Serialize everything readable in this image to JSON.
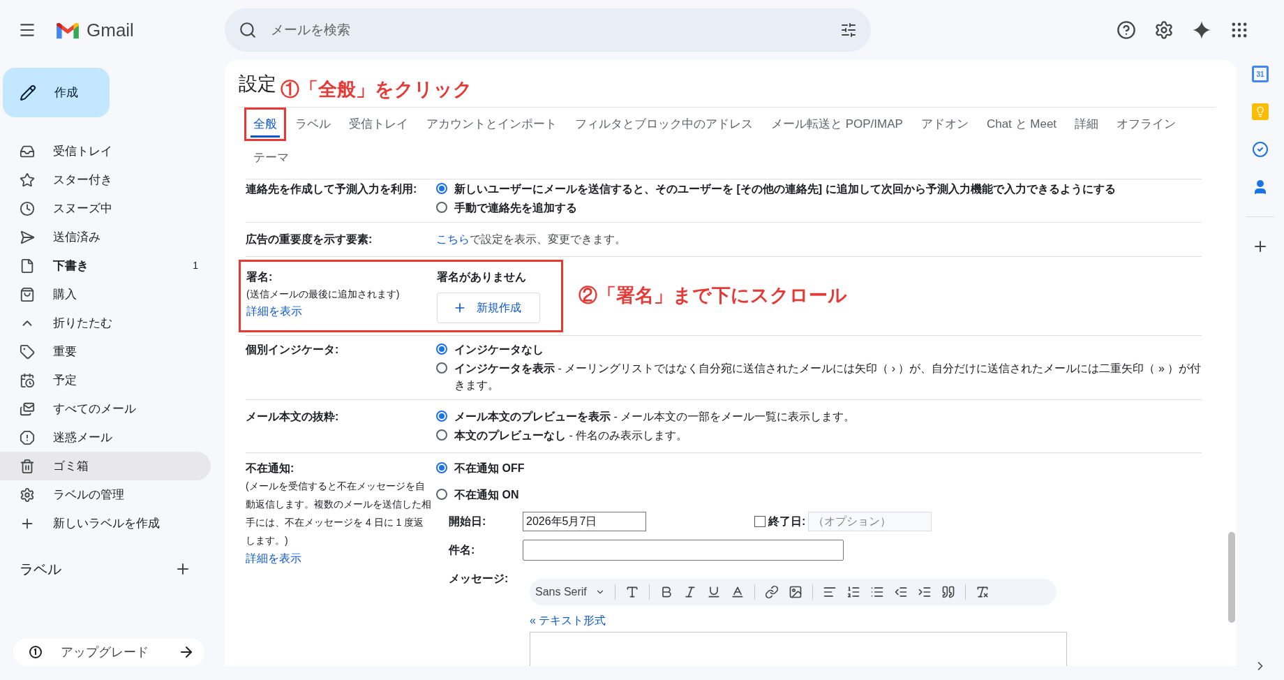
{
  "header": {
    "logo": "Gmail",
    "search": {
      "placeholder": "メールを検索"
    }
  },
  "sidebar": {
    "compose": "作成",
    "items": [
      {
        "label": "受信トレイ",
        "unread": false,
        "selected": false
      },
      {
        "label": "スター付き",
        "unread": false,
        "selected": false
      },
      {
        "label": "スヌーズ中",
        "unread": false,
        "selected": false
      },
      {
        "label": "送信済み",
        "unread": false,
        "selected": false
      },
      {
        "label": "下書き",
        "unread": true,
        "count": "1",
        "selected": false
      },
      {
        "label": "購入",
        "unread": false,
        "selected": false
      },
      {
        "label": "折りたたむ",
        "unread": false,
        "selected": false
      },
      {
        "label": "重要",
        "unread": false,
        "selected": false
      },
      {
        "label": "予定",
        "unread": false,
        "selected": false
      },
      {
        "label": "すべてのメール",
        "unread": false,
        "selected": false
      },
      {
        "label": "迷惑メール",
        "unread": false,
        "selected": false
      },
      {
        "label": "ゴミ箱",
        "unread": false,
        "selected": true
      },
      {
        "label": "ラベルの管理",
        "unread": false,
        "selected": false
      },
      {
        "label": "新しいラベルを作成",
        "unread": false,
        "selected": false
      }
    ],
    "labels_header": "ラベル",
    "upgrade": "アップグレード"
  },
  "settings": {
    "title": "設定",
    "annotation": "①「全般」をクリック",
    "tabs": [
      {
        "label": "全般",
        "selected": true,
        "annotated": true
      },
      {
        "label": "ラベル",
        "selected": false,
        "annotated": false
      },
      {
        "label": "受信トレイ",
        "selected": false,
        "annotated": false
      },
      {
        "label": "アカウントとインポート",
        "selected": false,
        "annotated": false
      },
      {
        "label": "フィルタとブロック中のアドレス",
        "selected": false,
        "annotated": false
      },
      {
        "label": "メール転送と POP/IMAP",
        "selected": false,
        "annotated": false
      },
      {
        "label": "アドオン",
        "selected": false,
        "annotated": false
      },
      {
        "label": "Chat と Meet",
        "selected": false,
        "annotated": false
      },
      {
        "label": "詳細",
        "selected": false,
        "annotated": false
      },
      {
        "label": "オフライン",
        "selected": false,
        "annotated": false
      },
      {
        "label": "テーマ",
        "selected": false,
        "annotated": false
      }
    ],
    "contacts": {
      "label": "連絡先を作成して予測入力を利用:",
      "options": [
        {
          "label": "新しいユーザーにメールを送信すると、そのユーザーを [その他の連絡先] に追加して次回から予測入力機能で入力できるようにする",
          "selected": true
        },
        {
          "label": "手動で連絡先を追加する",
          "selected": false
        }
      ]
    },
    "ads": {
      "label": "広告の重要度を示す要素:",
      "link": "こちら",
      "text": "で設定を表示、変更できます。"
    },
    "signature": {
      "label": "署名:",
      "note": "(送信メールの最後に追加されます)",
      "link": "詳細を表示",
      "status": "署名がありません",
      "button": "新規作成",
      "annotated": true,
      "annotation": "②「署名」まで下にスクロール"
    },
    "indicators": {
      "label": "個別インジケータ:",
      "options": [
        {
          "label": "インジケータなし",
          "selected": true
        },
        {
          "label": "インジケータを表示",
          "description": " - メーリングリストではなく自分宛に送信されたメールには矢印（ › ）が、自分だけに送信されたメールには二重矢印（ » ）が付きます。",
          "selected": false
        }
      ]
    },
    "snippets": {
      "label": "メール本文の抜粋:",
      "options": [
        {
          "label": "メール本文のプレビューを表示",
          "description": " - メール本文の一部をメール一覧に表示します。",
          "selected": true
        },
        {
          "label": "本文のプレビューなし",
          "description": " - 件名のみ表示します。",
          "selected": false
        }
      ]
    },
    "vacation": {
      "label": "不在通知:",
      "note": "(メールを受信すると不在メッセージを自動返信します。複数のメールを送信した相手には、不在メッセージを 4 日に 1 度返します。)",
      "link": "詳細を表示",
      "options": [
        {
          "label": "不在通知 OFF",
          "selected": true
        },
        {
          "label": "不在通知 ON",
          "selected": false
        }
      ],
      "start_label": "開始日:",
      "start_value": "2026年5月7日",
      "end_checked": false,
      "end_label": "終了日:",
      "end_placeholder": "（オプション）",
      "subject_label": "件名:",
      "message_label": "メッセージ:",
      "font": "Sans Serif",
      "plain_text_link": "« テキスト形式"
    }
  },
  "right_rail": {
    "calendar_day": "31"
  }
}
